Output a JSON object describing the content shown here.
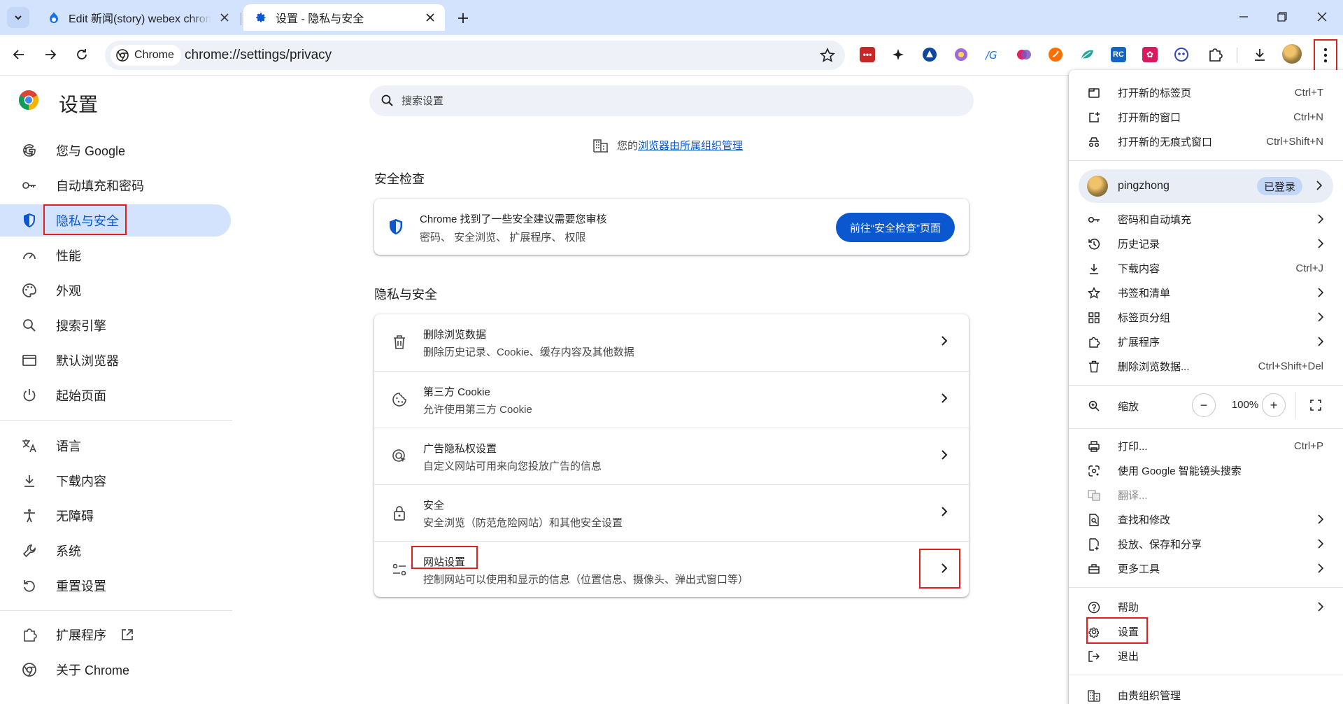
{
  "tabs": [
    {
      "title": "Edit 新闻(story) webex chrom",
      "active": false
    },
    {
      "title": "设置 - 隐私与安全",
      "active": true
    }
  ],
  "toolbar": {
    "chip_label": "Chrome",
    "url": "chrome://settings/privacy",
    "extensions": [
      "password-manager-ext",
      "sparkle-ext",
      "triangle-ext",
      "gear-flower-ext",
      "g-translate-ext",
      "brain-ext",
      "orange-ext",
      "leaf-ext",
      "rc-ext",
      "pink-ext",
      "face-ext",
      "puzzle-extensions"
    ],
    "accent": "#0b57d0"
  },
  "sidebar": {
    "title": "设置",
    "items": [
      {
        "label": "您与 Google",
        "icon": "google-g-icon"
      },
      {
        "label": "自动填充和密码",
        "icon": "key-icon"
      },
      {
        "label": "隐私与安全",
        "icon": "shield-icon",
        "active": true
      },
      {
        "label": "性能",
        "icon": "speedometer-icon"
      },
      {
        "label": "外观",
        "icon": "palette-icon"
      },
      {
        "label": "搜索引擎",
        "icon": "search-icon"
      },
      {
        "label": "默认浏览器",
        "icon": "browser-window-icon"
      },
      {
        "label": "起始页面",
        "icon": "power-icon"
      },
      {
        "label": "语言",
        "icon": "translate-icon"
      },
      {
        "label": "下载内容",
        "icon": "download-icon"
      },
      {
        "label": "无障碍",
        "icon": "accessibility-icon"
      },
      {
        "label": "系统",
        "icon": "wrench-icon"
      },
      {
        "label": "重置设置",
        "icon": "reset-icon"
      },
      {
        "label": "扩展程序",
        "icon": "puzzle-icon"
      },
      {
        "label": "关于 Chrome",
        "icon": "chrome-icon"
      }
    ]
  },
  "main": {
    "search_placeholder": "搜索设置",
    "managed_prefix": "您的",
    "managed_link": "浏览器由所属组织管理",
    "safety_check": {
      "section_title": "安全检查",
      "title": "Chrome 找到了一些安全建议需要您审核",
      "subtitle": "密码、 安全浏览、 扩展程序、 权限",
      "button": "前往“安全检查”页面"
    },
    "privacy": {
      "section_title": "隐私与安全",
      "rows": [
        {
          "title": "删除浏览数据",
          "subtitle": "删除历史记录、Cookie、缓存内容及其他数据",
          "icon": "trash-icon"
        },
        {
          "title": "第三方 Cookie",
          "subtitle": "允许使用第三方 Cookie",
          "icon": "cookie-icon"
        },
        {
          "title": "广告隐私权设置",
          "subtitle": "自定义网站可用来向您投放广告的信息",
          "icon": "ad-privacy-icon"
        },
        {
          "title": "安全",
          "subtitle": "安全浏览（防范危险网站）和其他安全设置",
          "icon": "lock-icon"
        },
        {
          "title": "网站设置",
          "subtitle": "控制网站可以使用和显示的信息（位置信息、摄像头、弹出式窗口等）",
          "icon": "tune-icon"
        }
      ]
    }
  },
  "menu": {
    "new_tab": {
      "label": "打开新的标签页",
      "shortcut": "Ctrl+T"
    },
    "new_window": {
      "label": "打开新的窗口",
      "shortcut": "Ctrl+N"
    },
    "incognito": {
      "label": "打开新的无痕式窗口",
      "shortcut": "Ctrl+Shift+N"
    },
    "profile": {
      "name": "pingzhong",
      "badge": "已登录"
    },
    "passwords": {
      "label": "密码和自动填充"
    },
    "history": {
      "label": "历史记录"
    },
    "downloads": {
      "label": "下载内容",
      "shortcut": "Ctrl+J"
    },
    "bookmarks": {
      "label": "书签和清单"
    },
    "tab_groups": {
      "label": "标签页分组"
    },
    "extensions": {
      "label": "扩展程序"
    },
    "clear_data": {
      "label": "删除浏览数据...",
      "shortcut": "Ctrl+Shift+Del"
    },
    "zoom": {
      "label": "缩放",
      "value": "100%",
      "minus": "−",
      "plus": "+"
    },
    "print": {
      "label": "打印...",
      "shortcut": "Ctrl+P"
    },
    "lens": {
      "label": "使用 Google 智能镜头搜索"
    },
    "translate": {
      "label": "翻译..."
    },
    "find": {
      "label": "查找和修改"
    },
    "cast": {
      "label": "投放、保存和分享"
    },
    "more_tools": {
      "label": "更多工具"
    },
    "help": {
      "label": "帮助"
    },
    "settings": {
      "label": "设置"
    },
    "exit": {
      "label": "退出"
    },
    "managed": {
      "label": "由贵组织管理"
    }
  }
}
